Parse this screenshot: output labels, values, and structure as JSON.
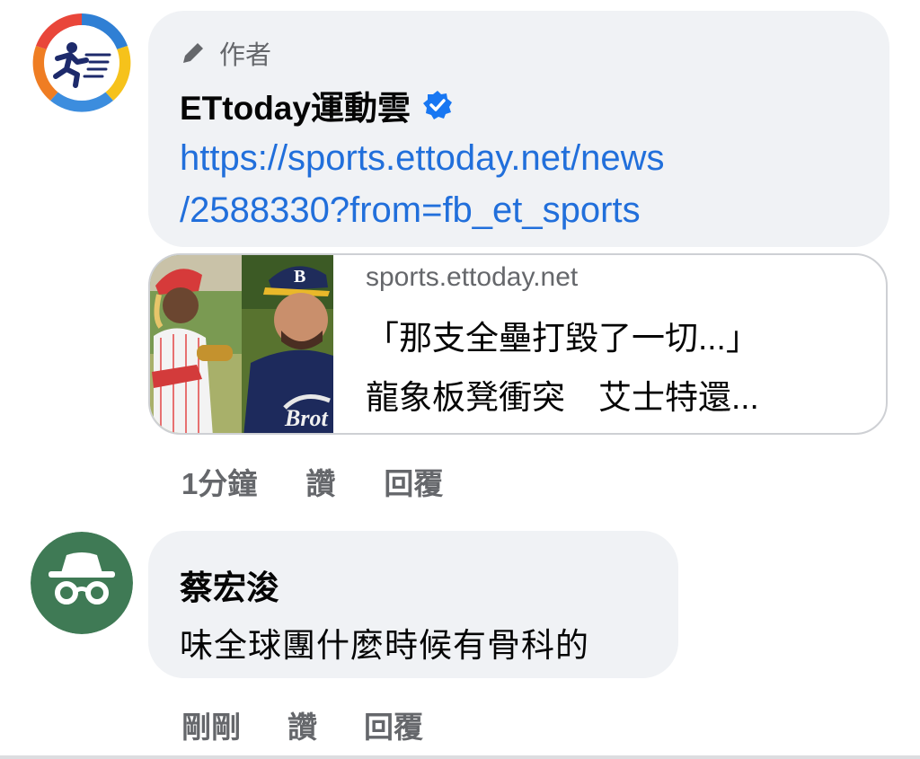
{
  "comment1": {
    "author_badge": "作者",
    "author_name": "ETtoday運動雲",
    "verified_icon": "verified-badge-icon",
    "link_line1": "https://sports.ettoday.net/news",
    "link_line2": "/2588330?from=fb_et_sports",
    "preview": {
      "domain": "sports.ettoday.net",
      "title_line1": "「那支全壘打毀了一切...」",
      "title_line2": "龍象板凳衝突　艾士特還..."
    },
    "meta": {
      "time": "1分鐘",
      "like": "讚",
      "reply": "回覆"
    }
  },
  "comment2": {
    "author_name": "蔡宏浚",
    "text": "味全球團什麼時候有骨科的",
    "meta": {
      "time": "剛剛",
      "like": "讚",
      "reply": "回覆"
    }
  },
  "colors": {
    "link": "#216fdb",
    "bubble": "#f0f2f5",
    "secondary_text": "#65676b",
    "verified": "#1877f2",
    "anon_avatar": "#3f7a55"
  }
}
